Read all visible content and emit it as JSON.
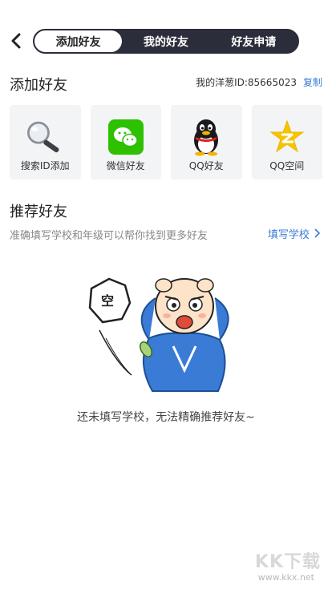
{
  "header": {
    "tabs": [
      {
        "label": "添加好友",
        "active": true
      },
      {
        "label": "我的好友",
        "active": false
      },
      {
        "label": "好友申请",
        "active": false
      }
    ]
  },
  "add_section": {
    "title": "添加好友",
    "id_label": "我的洋葱ID:85665023",
    "copy_label": "复制"
  },
  "options": [
    {
      "label": "搜索ID添加",
      "icon": "magnifier-icon"
    },
    {
      "label": "微信好友",
      "icon": "wechat-icon"
    },
    {
      "label": "QQ好友",
      "icon": "qq-penguin-icon"
    },
    {
      "label": "QQ空间",
      "icon": "qzone-star-icon"
    }
  ],
  "recommend": {
    "title": "推荐好友",
    "subtitle": "准确填写学校和年级可以帮你找到更多好友",
    "link_label": "填写学校",
    "bubble_text": "空",
    "empty_message": "还未填写学校，无法精确推荐好友~"
  },
  "watermark": {
    "logo_text": "KK下载",
    "url": "www.kkx.net"
  },
  "colors": {
    "accent": "#3a7bd5",
    "tab_bg": "#2b2d3a",
    "card_bg": "#f3f4f6"
  }
}
